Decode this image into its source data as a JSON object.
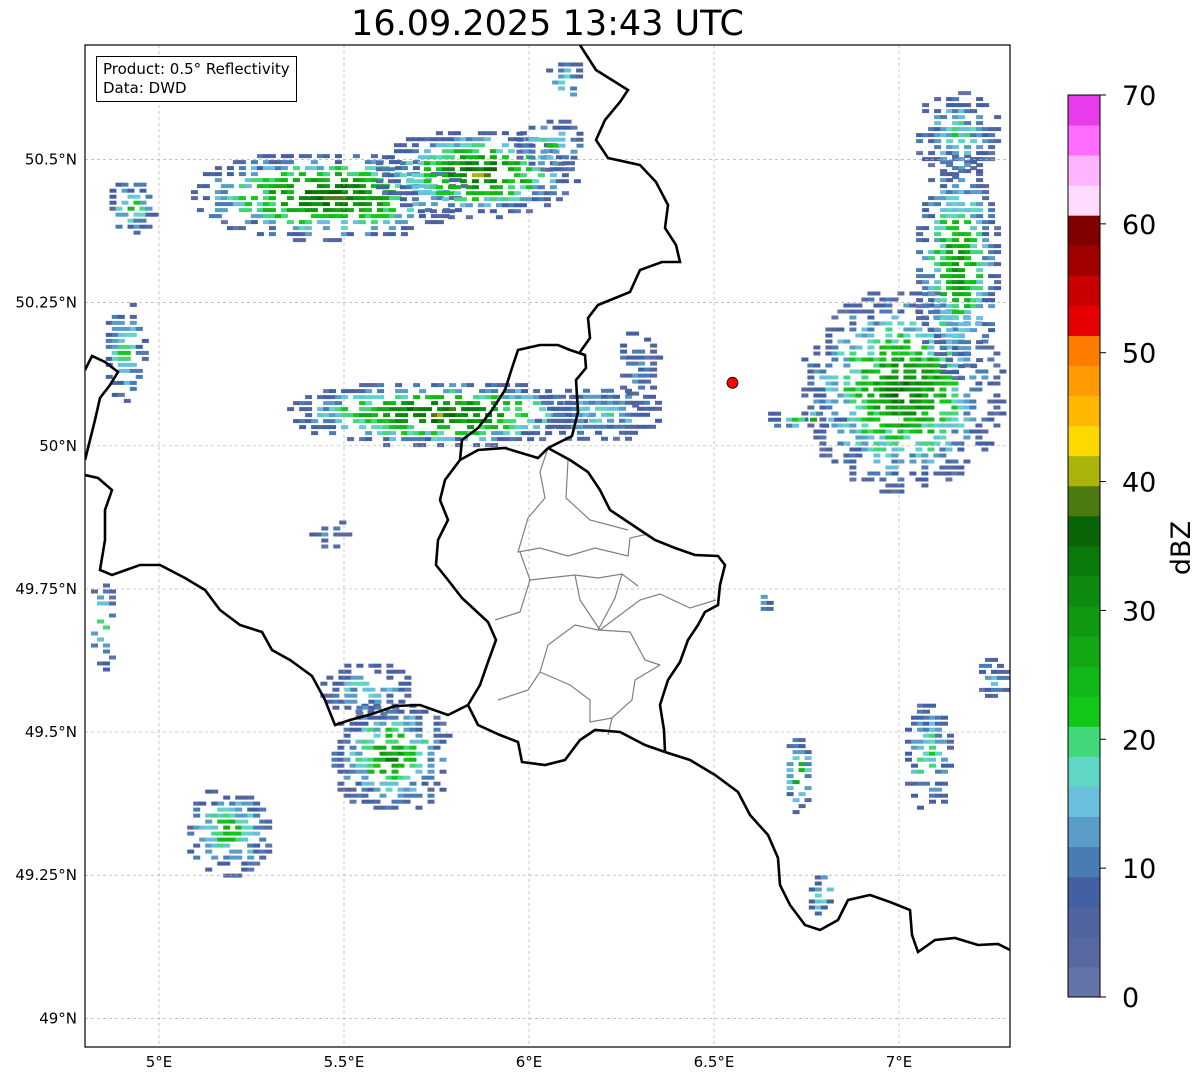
{
  "title": "16.09.2025 13:43 UTC",
  "info": {
    "product_line": "Product: 0.5° Reflectivity",
    "data_line": "Data: DWD"
  },
  "map": {
    "lon_range": [
      4.8,
      7.3
    ],
    "lat_range": [
      48.95,
      50.7
    ],
    "lon_ticks": [
      {
        "value": 5.0,
        "label": "5°E"
      },
      {
        "value": 5.5,
        "label": "5.5°E"
      },
      {
        "value": 6.0,
        "label": "6°E"
      },
      {
        "value": 6.5,
        "label": "6.5°E"
      },
      {
        "value": 7.0,
        "label": "7°E"
      }
    ],
    "lat_ticks": [
      {
        "value": 50.5,
        "label": "50.5°N"
      },
      {
        "value": 50.25,
        "label": "50.25°N"
      },
      {
        "value": 50.0,
        "label": "50°N"
      },
      {
        "value": 49.75,
        "label": "49.75°N"
      },
      {
        "value": 49.5,
        "label": "49.5°N"
      },
      {
        "value": 49.25,
        "label": "49.25°N"
      },
      {
        "value": 49.0,
        "label": "49°N"
      }
    ],
    "radar_site": {
      "lon": 6.55,
      "lat": 50.11,
      "color": "#ff0000"
    },
    "border_color": "#000000",
    "district_color": "#808080",
    "grid_color": "#b0b0b0"
  },
  "colorbar": {
    "label": "dBZ",
    "min": 0,
    "max": 70,
    "step": 2.5,
    "ticks": [
      {
        "value": 0,
        "label": "0"
      },
      {
        "value": 10,
        "label": "10"
      },
      {
        "value": 20,
        "label": "20"
      },
      {
        "value": 30,
        "label": "30"
      },
      {
        "value": 40,
        "label": "40"
      },
      {
        "value": 50,
        "label": "50"
      },
      {
        "value": 60,
        "label": "60"
      },
      {
        "value": 70,
        "label": "70"
      }
    ],
    "colors": [
      "#6574a8",
      "#5868a0",
      "#5064a0",
      "#4460a4",
      "#4a7cb4",
      "#5a9cc8",
      "#6ac0dc",
      "#60d6c4",
      "#40d878",
      "#12c818",
      "#12b818",
      "#14a814",
      "#109810",
      "#0e8a10",
      "#0a7a0c",
      "#0a6408",
      "#4a7a10",
      "#aab40a",
      "#ffd800",
      "#ffb800",
      "#ff9a00",
      "#ff7c00",
      "#e60000",
      "#c80000",
      "#a00000",
      "#800000",
      "#ffdcff",
      "#ffb4ff",
      "#ff6cff",
      "#e83cec"
    ]
  },
  "echo_cells": [
    {
      "lon": 5.45,
      "lat": 50.44,
      "rlon": 0.38,
      "rlat": 0.08,
      "peak": 43
    },
    {
      "lon": 5.85,
      "lat": 50.48,
      "rlon": 0.28,
      "rlat": 0.08,
      "peak": 42
    },
    {
      "lon": 6.05,
      "lat": 50.53,
      "rlon": 0.1,
      "rlat": 0.05,
      "peak": 22
    },
    {
      "lon": 4.92,
      "lat": 50.42,
      "rlon": 0.07,
      "rlat": 0.05,
      "peak": 26
    },
    {
      "lon": 4.9,
      "lat": 50.17,
      "rlon": 0.06,
      "rlat": 0.09,
      "peak": 24
    },
    {
      "lon": 5.75,
      "lat": 50.06,
      "rlon": 0.42,
      "rlat": 0.06,
      "peak": 44
    },
    {
      "lon": 6.18,
      "lat": 50.06,
      "rlon": 0.18,
      "rlat": 0.05,
      "peak": 20
    },
    {
      "lon": 7.0,
      "lat": 50.1,
      "rlon": 0.28,
      "rlat": 0.18,
      "peak": 38
    },
    {
      "lon": 7.15,
      "lat": 50.32,
      "rlon": 0.12,
      "rlat": 0.2,
      "peak": 34
    },
    {
      "lon": 6.74,
      "lat": 50.05,
      "rlon": 0.11,
      "rlat": 0.02,
      "peak": 28
    },
    {
      "lon": 5.62,
      "lat": 49.46,
      "rlon": 0.17,
      "rlat": 0.1,
      "peak": 33
    },
    {
      "lon": 5.18,
      "lat": 49.33,
      "rlon": 0.12,
      "rlat": 0.08,
      "peak": 28
    },
    {
      "lon": 4.84,
      "lat": 49.69,
      "rlon": 0.04,
      "rlat": 0.08,
      "peak": 22
    },
    {
      "lon": 6.72,
      "lat": 49.43,
      "rlon": 0.04,
      "rlat": 0.07,
      "peak": 34
    },
    {
      "lon": 6.78,
      "lat": 49.22,
      "rlon": 0.04,
      "rlat": 0.04,
      "peak": 24
    },
    {
      "lon": 7.07,
      "lat": 49.46,
      "rlon": 0.07,
      "rlat": 0.1,
      "peak": 24
    },
    {
      "lon": 7.25,
      "lat": 49.6,
      "rlon": 0.05,
      "rlat": 0.04,
      "peak": 16
    },
    {
      "lon": 6.63,
      "lat": 49.73,
      "rlon": 0.02,
      "rlat": 0.02,
      "peak": 20
    },
    {
      "lon": 6.29,
      "lat": 50.14,
      "rlon": 0.06,
      "rlat": 0.07,
      "peak": 14
    },
    {
      "lon": 6.09,
      "lat": 50.64,
      "rlon": 0.06,
      "rlat": 0.04,
      "peak": 22
    },
    {
      "lon": 5.55,
      "lat": 49.58,
      "rlon": 0.13,
      "rlat": 0.05,
      "peak": 20
    },
    {
      "lon": 5.45,
      "lat": 49.85,
      "rlon": 0.06,
      "rlat": 0.03,
      "peak": 10
    },
    {
      "lon": 7.15,
      "lat": 50.55,
      "rlon": 0.12,
      "rlat": 0.08,
      "peak": 22
    }
  ]
}
